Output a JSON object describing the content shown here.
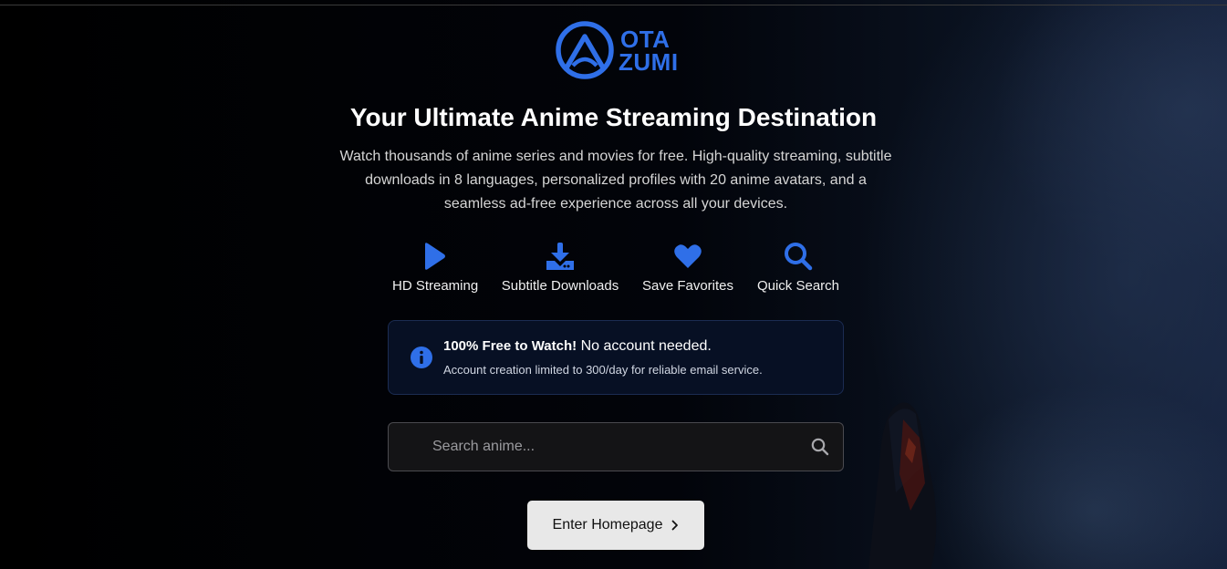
{
  "brand": {
    "logo_line1": "OTA",
    "logo_line2": "ZUMI",
    "accent_color": "#2f6fe8"
  },
  "hero": {
    "title": "Your Ultimate Anime Streaming Destination",
    "description": "Watch thousands of anime series and movies for free. High-quality streaming, subtitle downloads in 8 languages, personalized profiles with 20 anime avatars, and a seamless ad-free experience across all your devices."
  },
  "features": [
    {
      "icon": "play-icon",
      "label": "HD Streaming"
    },
    {
      "icon": "download-icon",
      "label": "Subtitle Downloads"
    },
    {
      "icon": "heart-icon",
      "label": "Save Favorites"
    },
    {
      "icon": "search-icon",
      "label": "Quick Search"
    }
  ],
  "notice": {
    "icon": "info-icon",
    "bold": "100% Free to Watch!",
    "text": " No account needed.",
    "subtext": "Account creation limited to 300/day for reliable email service."
  },
  "search": {
    "placeholder": "Search anime...",
    "value": "",
    "icon": "search-icon"
  },
  "cta": {
    "label": "Enter Homepage",
    "icon": "chevron-right-icon"
  }
}
